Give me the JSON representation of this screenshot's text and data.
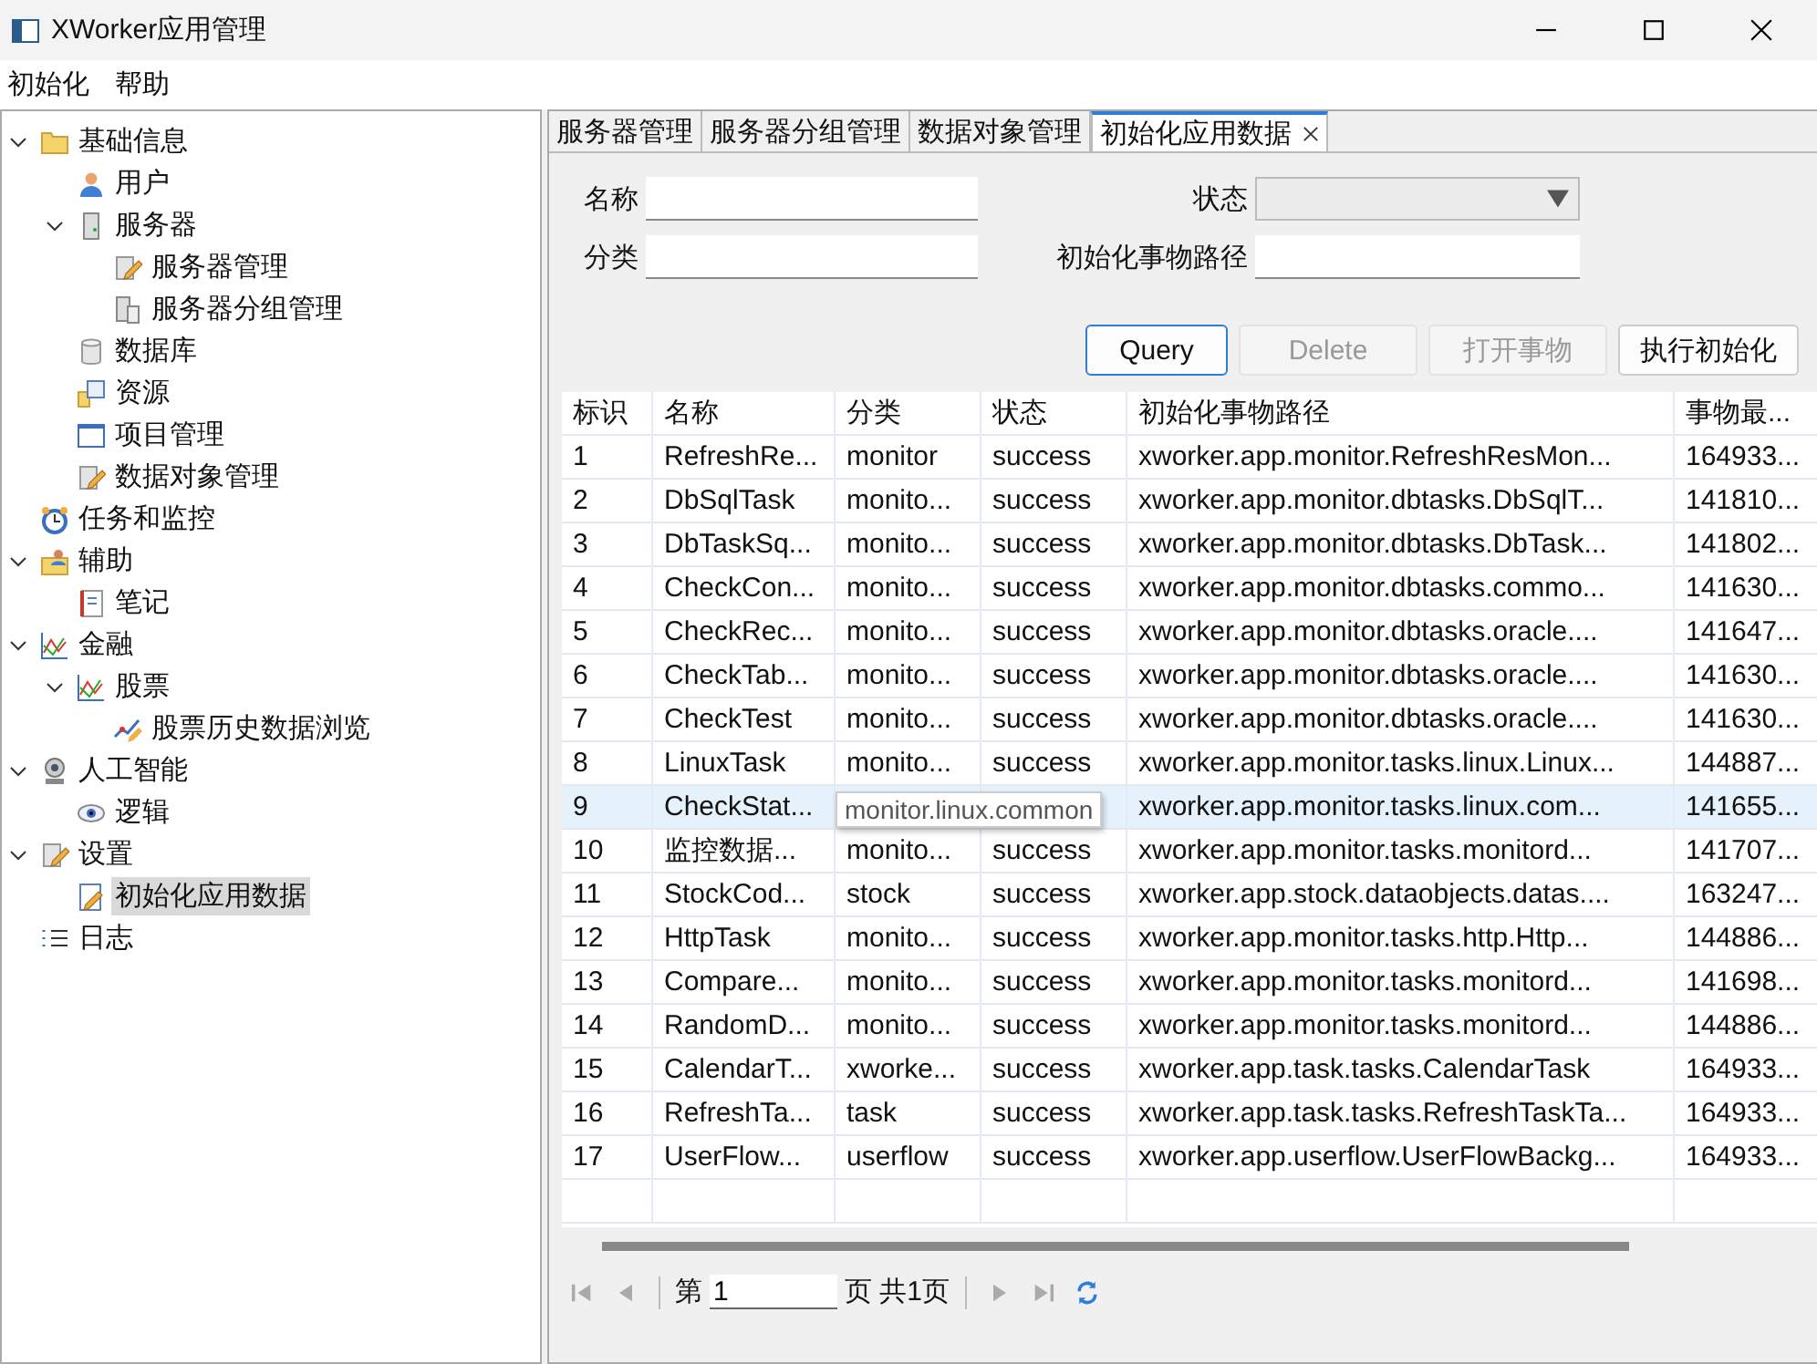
{
  "window": {
    "title": "XWorker应用管理"
  },
  "menu": [
    "初始化",
    "帮助"
  ],
  "tree": [
    {
      "label": "基础信息",
      "kind": "folder",
      "expanded": true,
      "selected": false,
      "children": [
        {
          "label": "用户",
          "kind": "user",
          "selected": false
        },
        {
          "label": "服务器",
          "kind": "server",
          "expanded": true,
          "selected": false,
          "children": [
            {
              "label": "服务器管理",
              "kind": "edit",
              "selected": false
            },
            {
              "label": "服务器分组管理",
              "kind": "servers",
              "selected": false
            }
          ]
        },
        {
          "label": "数据库",
          "kind": "database",
          "selected": false
        },
        {
          "label": "资源",
          "kind": "resource",
          "selected": false
        },
        {
          "label": "项目管理",
          "kind": "window",
          "selected": false
        },
        {
          "label": "数据对象管理",
          "kind": "edit",
          "selected": false
        }
      ]
    },
    {
      "label": "任务和监控",
      "kind": "clock",
      "selected": false
    },
    {
      "label": "辅助",
      "kind": "userfolder",
      "expanded": true,
      "selected": false,
      "children": [
        {
          "label": "笔记",
          "kind": "notebook",
          "selected": false
        }
      ]
    },
    {
      "label": "金融",
      "kind": "chart",
      "expanded": true,
      "selected": false,
      "children": [
        {
          "label": "股票",
          "kind": "chart",
          "expanded": true,
          "selected": false,
          "children": [
            {
              "label": "股票历史数据浏览",
              "kind": "stock",
              "selected": false
            }
          ]
        }
      ]
    },
    {
      "label": "人工智能",
      "kind": "robot",
      "expanded": true,
      "selected": false,
      "children": [
        {
          "label": "逻辑",
          "kind": "eye",
          "selected": false
        }
      ]
    },
    {
      "label": "设置",
      "kind": "edit",
      "expanded": true,
      "selected": false,
      "children": [
        {
          "label": "初始化应用数据",
          "kind": "editdoc",
          "selected": true
        }
      ]
    },
    {
      "label": "日志",
      "kind": "list",
      "selected": false
    }
  ],
  "tabs": [
    {
      "label": "服务器管理",
      "selected": false
    },
    {
      "label": "服务器分组管理",
      "selected": false
    },
    {
      "label": "数据对象管理",
      "selected": false
    },
    {
      "label": "初始化应用数据",
      "selected": true,
      "closable": true
    }
  ],
  "form": {
    "name_label": "名称",
    "category_label": "分类",
    "status_label": "状态",
    "path_label": "初始化事物路径"
  },
  "buttons": [
    {
      "label": "Query",
      "disabled": false,
      "focused": true
    },
    {
      "label": "Delete",
      "disabled": true,
      "focused": false
    },
    {
      "label": "打开事物",
      "disabled": true,
      "focused": false
    },
    {
      "label": "执行初始化",
      "disabled": false,
      "focused": false
    }
  ],
  "table": {
    "columns": [
      "标识",
      "名称",
      "分类",
      "状态",
      "初始化事物路径",
      "事物最..."
    ],
    "rows": [
      {
        "selected": false,
        "cells": [
          "1",
          "RefreshRe...",
          "monitor",
          "success",
          "xworker.app.monitor.RefreshResMon...",
          "164933..."
        ]
      },
      {
        "selected": false,
        "cells": [
          "2",
          "DbSqlTask",
          "monito...",
          "success",
          "xworker.app.monitor.dbtasks.DbSqlT...",
          "141810..."
        ]
      },
      {
        "selected": false,
        "cells": [
          "3",
          "DbTaskSq...",
          "monito...",
          "success",
          "xworker.app.monitor.dbtasks.DbTask...",
          "141802..."
        ]
      },
      {
        "selected": false,
        "cells": [
          "4",
          "CheckCon...",
          "monito...",
          "success",
          "xworker.app.monitor.dbtasks.commo...",
          "141630..."
        ]
      },
      {
        "selected": false,
        "cells": [
          "5",
          "CheckRec...",
          "monito...",
          "success",
          "xworker.app.monitor.dbtasks.oracle....",
          "141647..."
        ]
      },
      {
        "selected": false,
        "cells": [
          "6",
          "CheckTab...",
          "monito...",
          "success",
          "xworker.app.monitor.dbtasks.oracle....",
          "141630..."
        ]
      },
      {
        "selected": false,
        "cells": [
          "7",
          "CheckTest",
          "monito...",
          "success",
          "xworker.app.monitor.dbtasks.oracle....",
          "141630..."
        ]
      },
      {
        "selected": false,
        "cells": [
          "8",
          "LinuxTask",
          "monito...",
          "success",
          "xworker.app.monitor.tasks.linux.Linux...",
          "144887..."
        ]
      },
      {
        "selected": true,
        "tooltip": "monitor.linux.common",
        "cells": [
          "9",
          "CheckStat...",
          null,
          null,
          "xworker.app.monitor.tasks.linux.com...",
          "141655..."
        ]
      },
      {
        "selected": false,
        "cells": [
          "10",
          "监控数据...",
          "monito...",
          "success",
          "xworker.app.monitor.tasks.monitord...",
          "141707..."
        ]
      },
      {
        "selected": false,
        "cells": [
          "11",
          "StockCod...",
          "stock",
          "success",
          "xworker.app.stock.dataobjects.datas....",
          "163247..."
        ]
      },
      {
        "selected": false,
        "cells": [
          "12",
          "HttpTask",
          "monito...",
          "success",
          "xworker.app.monitor.tasks.http.Http...",
          "144886..."
        ]
      },
      {
        "selected": false,
        "cells": [
          "13",
          "Compare...",
          "monito...",
          "success",
          "xworker.app.monitor.tasks.monitord...",
          "141698..."
        ]
      },
      {
        "selected": false,
        "cells": [
          "14",
          "RandomD...",
          "monito...",
          "success",
          "xworker.app.monitor.tasks.monitord...",
          "144886..."
        ]
      },
      {
        "selected": false,
        "cells": [
          "15",
          "CalendarT...",
          "xworke...",
          "success",
          "xworker.app.task.tasks.CalendarTask",
          "164933..."
        ]
      },
      {
        "selected": false,
        "cells": [
          "16",
          "RefreshTa...",
          "task",
          "success",
          "xworker.app.task.tasks.RefreshTaskTa...",
          "164933..."
        ]
      },
      {
        "selected": false,
        "cells": [
          "17",
          "UserFlow...",
          "userflow",
          "success",
          "xworker.app.userflow.UserFlowBackg...",
          "164933..."
        ]
      }
    ]
  },
  "pager": {
    "prefix": "第",
    "page": "1",
    "suffix": "页 共1页"
  }
}
